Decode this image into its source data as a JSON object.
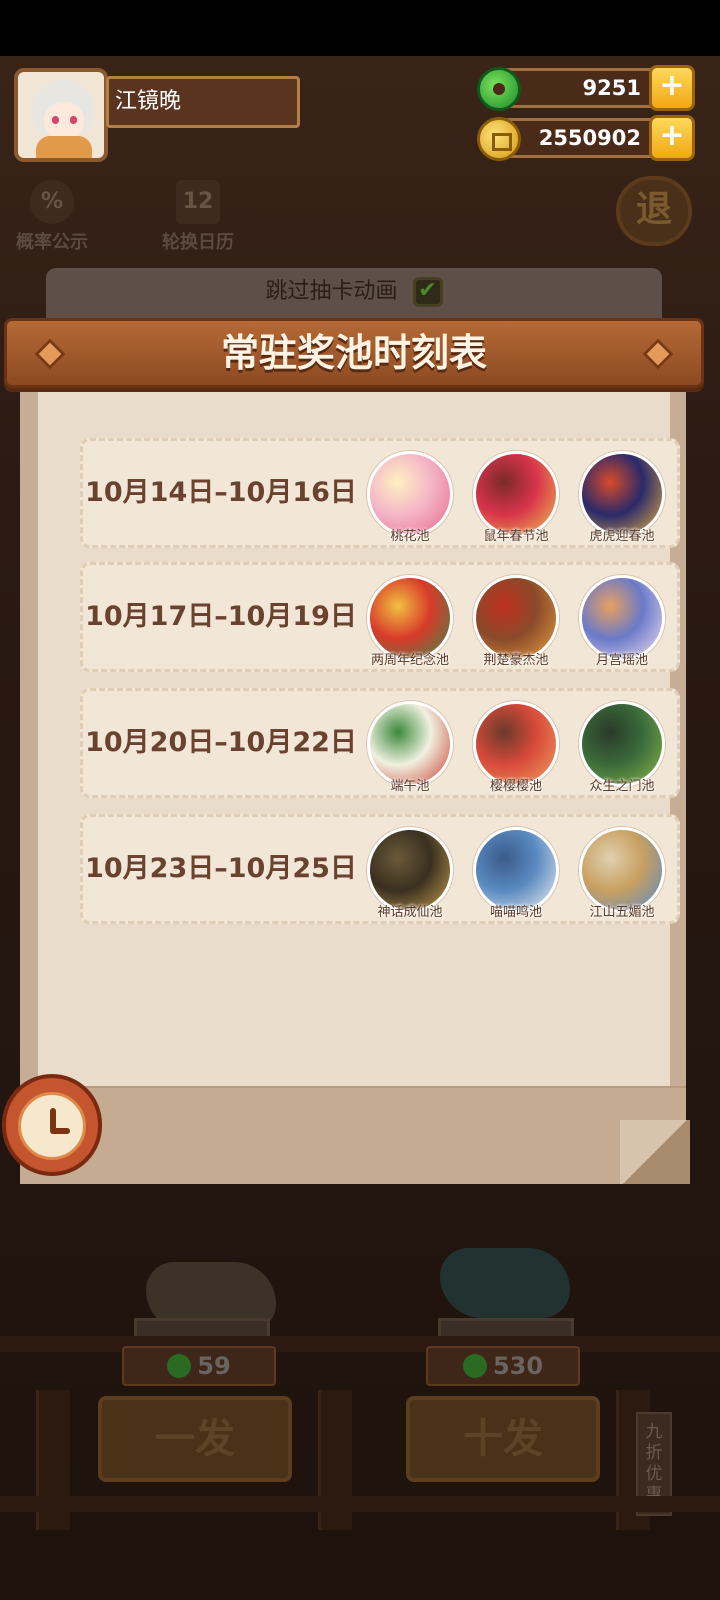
{
  "player": {
    "name": "江镜晚"
  },
  "currency": {
    "jade": "9251",
    "coins": "2550902",
    "plus": "+"
  },
  "side_buttons": {
    "probability": "概率公示",
    "calendar": "轮换日历",
    "exit": "退",
    "percent_glyph": "%",
    "calendar_glyph": "12"
  },
  "skip_animation": {
    "label": "跳过抽卡动画",
    "checked": true,
    "check_glyph": "✔"
  },
  "modal": {
    "title": "常驻奖池时刻表",
    "rows": [
      {
        "date": "10月14日–10月16日",
        "pools": [
          {
            "name": "桃花池",
            "colors": [
              "#f4b6c8",
              "#e86a8a",
              "#fff0c0"
            ]
          },
          {
            "name": "鼠年春节池",
            "colors": [
              "#d8344a",
              "#f0c050",
              "#7a2a2a"
            ]
          },
          {
            "name": "虎虎迎春池",
            "colors": [
              "#2a2a6a",
              "#e8b040",
              "#d84a2a"
            ]
          }
        ]
      },
      {
        "date": "10月17日–10月19日",
        "pools": [
          {
            "name": "两周年纪念池",
            "colors": [
              "#d83a2a",
              "#3a8a4a",
              "#f0c040"
            ]
          },
          {
            "name": "荆楚豪杰池",
            "colors": [
              "#8a4a2a",
              "#e8a040",
              "#c03020"
            ]
          },
          {
            "name": "月宫瑶池",
            "colors": [
              "#6a7ac8",
              "#f4e0f0",
              "#e8a060"
            ]
          }
        ]
      },
      {
        "date": "10月20日–10月22日",
        "pools": [
          {
            "name": "端午池",
            "colors": [
              "#f0f0e0",
              "#c83a2a",
              "#3a8a3a"
            ]
          },
          {
            "name": "樱樱樱池",
            "colors": [
              "#d84a3a",
              "#f0a060",
              "#6a3a2a"
            ]
          },
          {
            "name": "众生之门池",
            "colors": [
              "#3a6a3a",
              "#8ab84a",
              "#2a3a2a"
            ]
          }
        ]
      },
      {
        "date": "10月23日–10月25日",
        "pools": [
          {
            "name": "神话成仙池",
            "colors": [
              "#3a3020",
              "#c8a050",
              "#6a5a3a"
            ]
          },
          {
            "name": "喵喵鸣池",
            "colors": [
              "#5a8ac0",
              "#f0f0f0",
              "#3a5a8a"
            ]
          },
          {
            "name": "江山五媚池",
            "colors": [
              "#c8a060",
              "#5a8ac8",
              "#e0d0b0"
            ]
          }
        ]
      }
    ]
  },
  "draw": {
    "single": {
      "label": "一发",
      "cost": "59"
    },
    "ten": {
      "label": "十发",
      "cost": "530"
    },
    "discount": "九折优惠"
  }
}
